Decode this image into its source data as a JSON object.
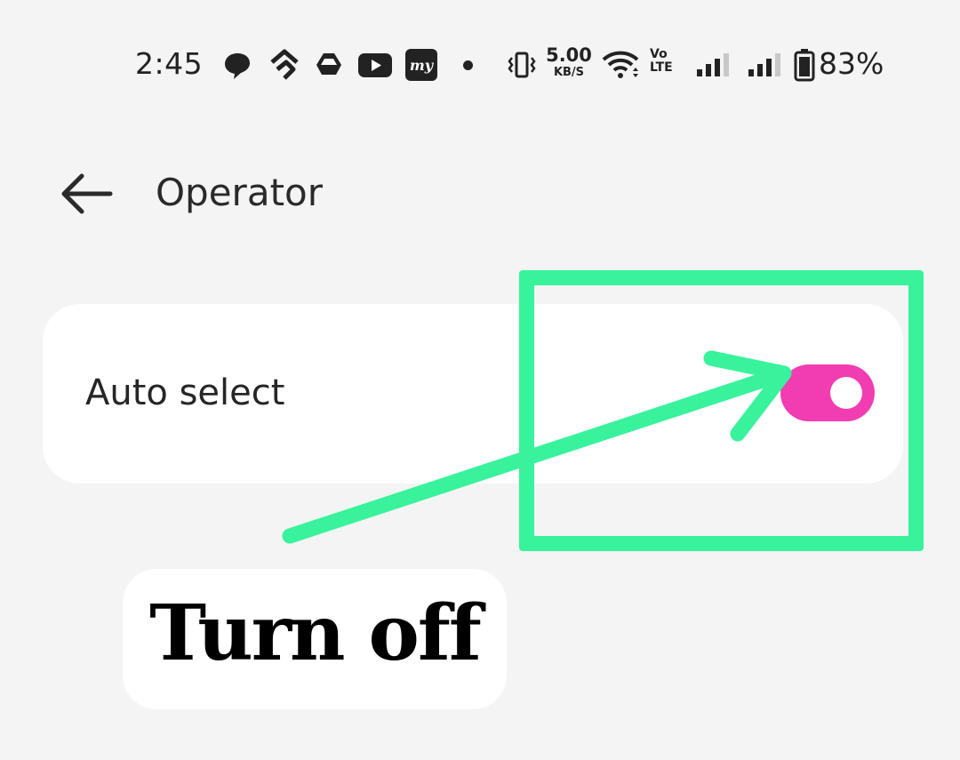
{
  "status_bar": {
    "time": "2:45",
    "notification_icons": [
      "chat-bubble-icon",
      "navigation-icon",
      "drive-icon",
      "youtube-icon",
      "my-app-icon"
    ],
    "network_speed_value": "5.00",
    "network_speed_unit": "KB/S",
    "volte_top": "Vo",
    "volte_bottom": "LTE",
    "battery_percent": "83%"
  },
  "header": {
    "title": "Operator"
  },
  "settings": {
    "auto_select_label": "Auto select",
    "auto_select_enabled": true
  },
  "annotation": {
    "callout_text": "Turn off",
    "highlight_color": "#38f29c"
  },
  "colors": {
    "toggle_on": "#f23cb1",
    "background": "#f4f4f4",
    "card": "#ffffff"
  }
}
